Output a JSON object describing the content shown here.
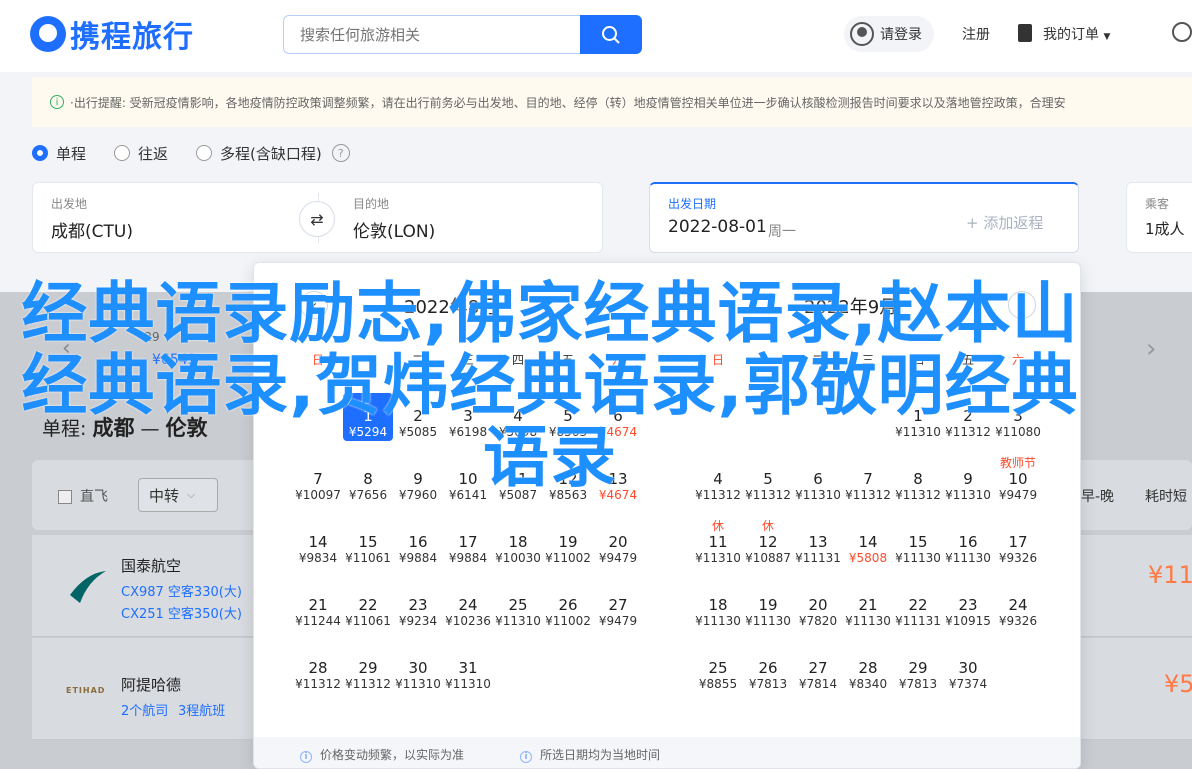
{
  "header": {
    "logo_text": "携程旅行",
    "search_placeholder": "搜索任何旅游相关",
    "login": "请登录",
    "register": "注册",
    "my_orders": "我的订单"
  },
  "notice": {
    "text": "·出行提醒: 受新冠疫情影响，各地疫情防控政策调整频繁，请在出行前务必与出发地、目的地、经停（转）地疫情管控相关单位进一步确认核酸检测报告时间要求以及落地管控政策，合理安"
  },
  "trip_types": [
    "单程",
    "往返",
    "多程(含缺口程)"
  ],
  "trip_selected": "单程",
  "search": {
    "from_label": "出发地",
    "from_value": "成都(CTU)",
    "to_label": "目的地",
    "to_value": "伦敦(LON)",
    "date_label": "出发日期",
    "date_value": "2022-08-01",
    "date_weekday": "周一",
    "add_return": "+ 添加返程",
    "passenger_label": "乘客",
    "passenger_value": "1成人"
  },
  "calendar": {
    "left_title": "2022年8月",
    "right_title": "2022年9月",
    "weekdays": [
      "日",
      "一",
      "二",
      "三",
      "四",
      "五",
      "六"
    ],
    "left_days": [
      {
        "d": "1",
        "p": "¥5294",
        "sel": true
      },
      {
        "d": "2",
        "p": "¥5085"
      },
      {
        "d": "3",
        "p": "¥6198"
      },
      {
        "d": "4",
        "p": "¥5098"
      },
      {
        "d": "5",
        "p": "¥8563"
      },
      {
        "d": "6",
        "p": "¥4674",
        "low": true
      },
      {
        "d": "7",
        "p": "¥10097"
      },
      {
        "d": "8",
        "p": "¥7656"
      },
      {
        "d": "9",
        "p": "¥7960"
      },
      {
        "d": "10",
        "p": "¥6141"
      },
      {
        "d": "11",
        "p": "¥5087"
      },
      {
        "d": "12",
        "p": "¥8563"
      },
      {
        "d": "13",
        "p": "¥4674",
        "low": true
      },
      {
        "d": "14",
        "p": "¥9834"
      },
      {
        "d": "15",
        "p": "¥11061"
      },
      {
        "d": "16",
        "p": "¥9884"
      },
      {
        "d": "17",
        "p": "¥9884"
      },
      {
        "d": "18",
        "p": "¥10030"
      },
      {
        "d": "19",
        "p": "¥11002"
      },
      {
        "d": "20",
        "p": "¥9479"
      },
      {
        "d": "21",
        "p": "¥11244"
      },
      {
        "d": "22",
        "p": "¥11061"
      },
      {
        "d": "23",
        "p": "¥9234"
      },
      {
        "d": "24",
        "p": "¥10236"
      },
      {
        "d": "25",
        "p": "¥11310"
      },
      {
        "d": "26",
        "p": "¥11002"
      },
      {
        "d": "27",
        "p": "¥9479"
      },
      {
        "d": "28",
        "p": "¥11312"
      },
      {
        "d": "29",
        "p": "¥11312"
      },
      {
        "d": "30",
        "p": "¥11310"
      },
      {
        "d": "31",
        "p": "¥11310"
      }
    ],
    "right_days": [
      {
        "d": "1",
        "p": "¥11310"
      },
      {
        "d": "2",
        "p": "¥11312"
      },
      {
        "d": "3",
        "p": "¥11080"
      },
      {
        "d": "4",
        "p": "¥11312"
      },
      {
        "d": "5",
        "p": "¥11312"
      },
      {
        "d": "6",
        "p": "¥11310"
      },
      {
        "d": "7",
        "p": "¥11312"
      },
      {
        "d": "8",
        "p": "¥11312"
      },
      {
        "d": "9",
        "p": "¥11310"
      },
      {
        "d": "10",
        "p": "¥9479",
        "tag": "教师节"
      },
      {
        "d": "11",
        "p": "¥11310",
        "tag": "休"
      },
      {
        "d": "12",
        "p": "¥10887",
        "tag": "休"
      },
      {
        "d": "13",
        "p": "¥11131"
      },
      {
        "d": "14",
        "p": "¥5808",
        "low": true
      },
      {
        "d": "15",
        "p": "¥11130"
      },
      {
        "d": "16",
        "p": "¥11130"
      },
      {
        "d": "17",
        "p": "¥9326"
      },
      {
        "d": "18",
        "p": "¥11130"
      },
      {
        "d": "19",
        "p": "¥11130"
      },
      {
        "d": "20",
        "p": "¥7820"
      },
      {
        "d": "21",
        "p": "¥11130"
      },
      {
        "d": "22",
        "p": "¥11131"
      },
      {
        "d": "23",
        "p": "¥10915"
      },
      {
        "d": "24",
        "p": "¥9326"
      },
      {
        "d": "25",
        "p": "¥8855"
      },
      {
        "d": "26",
        "p": "¥7813"
      },
      {
        "d": "27",
        "p": "¥7814"
      },
      {
        "d": "28",
        "p": "¥8340"
      },
      {
        "d": "29",
        "p": "¥7813"
      },
      {
        "d": "30",
        "p": "¥7374"
      }
    ],
    "footer_note1": "价格变动频繁，以实际为准",
    "footer_note2": "所选日期均为当地时间"
  },
  "strip": {
    "date": "-29",
    "price": "¥6543"
  },
  "results": {
    "route_prefix": "单程:",
    "route_from": "成都",
    "route_to": "伦敦",
    "direct_label": "直飞",
    "transfer_label": "中转",
    "sort_early_late": "早-晚",
    "sort_duration": "耗时短",
    "flights": [
      {
        "airline": "国泰航空",
        "line1": "CX987 空客330(大)",
        "line2": "CX251 空客350(大)",
        "price": "¥11"
      },
      {
        "airline": "阿提哈德",
        "line1": "2个航司",
        "line2": "3程航班",
        "price": "¥5"
      }
    ]
  },
  "overlay_headline": "经典语录励志,佛家经典语录,赵本山经典语录,贺炜经典语录,郭敬明经典语录",
  "colors": {
    "brand": "#1e6fff",
    "headline": "#1e8fff",
    "low_price": "#ff4b2b",
    "price": "#ff7a45"
  }
}
